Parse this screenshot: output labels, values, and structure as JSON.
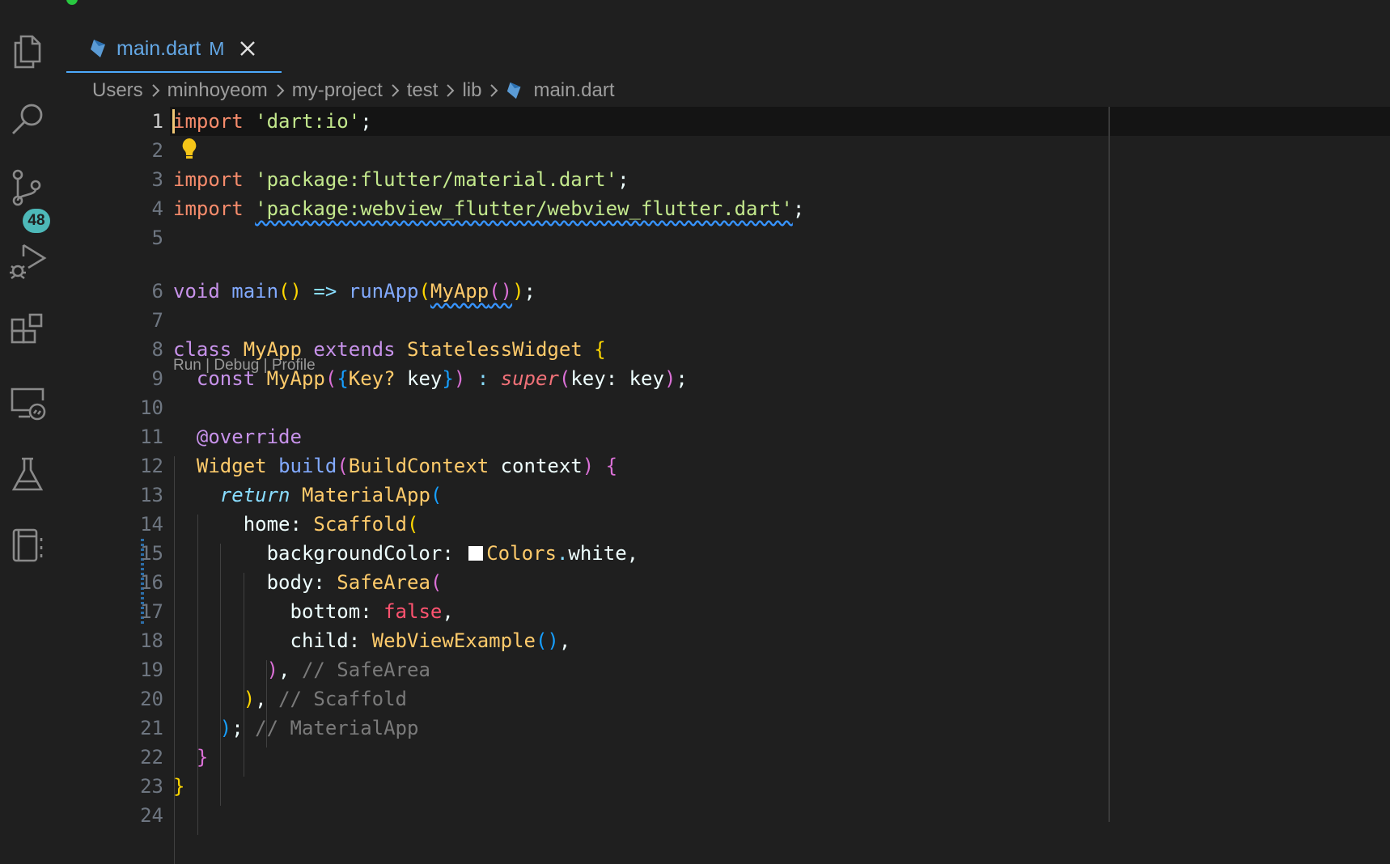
{
  "tab": {
    "filename": "main.dart",
    "status": "M"
  },
  "breadcrumb": [
    "Users",
    "minhoyeom",
    "my-project",
    "test",
    "lib",
    "main.dart"
  ],
  "activity_bar": {
    "items": [
      "explorer-icon",
      "search-icon",
      "source-control-icon",
      "run-debug-icon",
      "extensions-icon",
      "remote-explorer-icon",
      "testing-icon",
      "notebook-icon"
    ],
    "source_control_badge": "48"
  },
  "codelens": "Run | Debug | Profile",
  "line_numbers": [
    "1",
    "2",
    "3",
    "4",
    "5",
    "6",
    "7",
    "8",
    "9",
    "10",
    "11",
    "12",
    "13",
    "14",
    "15",
    "16",
    "17",
    "18",
    "19",
    "20",
    "21",
    "22",
    "23",
    "24"
  ],
  "code": {
    "l1": {
      "k": "import",
      "s": "'dart:io'",
      "p": ";"
    },
    "l3": {
      "k": "import",
      "s": "'package:flutter/material.dart'",
      "p": ";"
    },
    "l4": {
      "k": "import",
      "s": "'package:webview_flutter/webview_flutter.dart'",
      "p": ";"
    },
    "l6": {
      "a": "void",
      "b": "main",
      "c": "()",
      "d": "=>",
      "e": "runApp",
      "f": "(",
      "g": "MyApp",
      "h": "()",
      "i": ")",
      "j": ";"
    },
    "l8": {
      "a": "class",
      "b": "MyApp",
      "c": "extends",
      "d": "StatelessWidget",
      "e": "{"
    },
    "l9": {
      "a": "const",
      "b": "MyApp",
      "c": "(",
      "d": "{",
      "e": "Key?",
      "f": "key",
      "g": "}",
      "h": ")",
      "i": ":",
      "j": "super",
      "k": "(",
      "l": "key:",
      "m": "key",
      "n": ")",
      "o": ";"
    },
    "l11": {
      "a": "@override"
    },
    "l12": {
      "a": "Widget",
      "b": "build",
      "c": "(",
      "d": "BuildContext",
      "e": "context",
      "f": ")",
      "g": "{"
    },
    "l13": {
      "a": "return",
      "b": "MaterialApp",
      "c": "("
    },
    "l14": {
      "a": "home:",
      "b": "Scaffold",
      "c": "("
    },
    "l15": {
      "a": "backgroundColor:",
      "b": "Colors",
      "c": ".",
      "d": "white",
      "e": ","
    },
    "l16": {
      "a": "body:",
      "b": "SafeArea",
      "c": "("
    },
    "l17": {
      "a": "bottom:",
      "b": "false",
      "c": ","
    },
    "l18": {
      "a": "child:",
      "b": "WebViewExample",
      "c": "()",
      "d": ","
    },
    "l19": {
      "a": ")",
      "b": ",",
      "c": "// SafeArea"
    },
    "l20": {
      "a": ")",
      "b": ",",
      "c": "// Scaffold"
    },
    "l21": {
      "a": ")",
      "b": ";",
      "c": "// MaterialApp"
    },
    "l22": {
      "a": "}"
    },
    "l23": {
      "a": "}"
    }
  },
  "colors": {
    "accent": "#4daafc",
    "background": "#1f1f1f",
    "badge": "#4db8b8"
  }
}
